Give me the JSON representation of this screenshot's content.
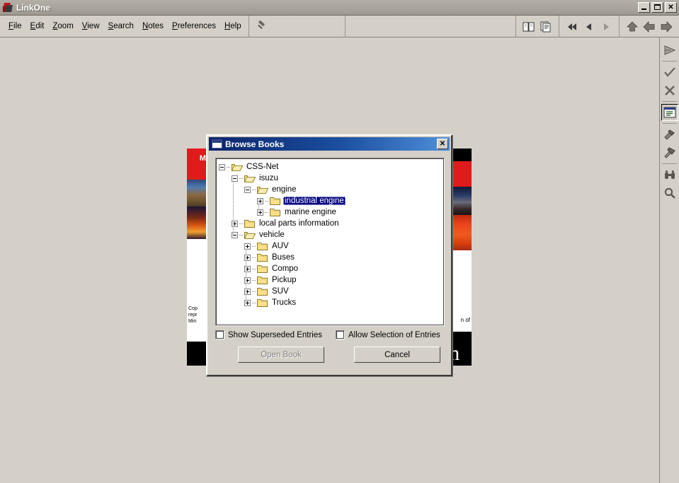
{
  "window": {
    "title": "LinkOne",
    "app_icon": "linkone-icon",
    "controls": {
      "minimize": "_",
      "maximize": "□",
      "close": "✕"
    }
  },
  "menubar": {
    "items": [
      {
        "label": "File",
        "accel": "F"
      },
      {
        "label": "Edit",
        "accel": "E"
      },
      {
        "label": "Zoom",
        "accel": "Z"
      },
      {
        "label": "View",
        "accel": "V"
      },
      {
        "label": "Search",
        "accel": "S"
      },
      {
        "label": "Notes",
        "accel": "N"
      },
      {
        "label": "Preferences",
        "accel": "P"
      },
      {
        "label": "Help",
        "accel": "H"
      }
    ],
    "pin_tool": "pushpin-icon"
  },
  "toolbar_right": {
    "groups": [
      {
        "buttons": [
          "book-icon",
          "document-notes-icon"
        ]
      },
      {
        "buttons": [
          "rewind-icon",
          "previous-icon",
          "next-icon"
        ]
      },
      {
        "buttons": [
          "arrow-up-icon",
          "arrow-left-icon",
          "arrow-right-icon"
        ]
      }
    ]
  },
  "toolbar_vertical": {
    "buttons": [
      {
        "name": "play-forward-icon",
        "pressed": false
      },
      {
        "name": "check-icon",
        "pressed": false
      },
      {
        "name": "cross-icon",
        "pressed": false
      },
      {
        "name": "list-panel-icon",
        "pressed": true
      },
      {
        "name": "hammer-icon",
        "pressed": false
      },
      {
        "name": "hammer-alt-icon",
        "pressed": false
      },
      {
        "name": "binoculars-icon",
        "pressed": false
      },
      {
        "name": "magnifier-icon",
        "pressed": false
      }
    ]
  },
  "background_document": {
    "cover_title": "Mi",
    "copyright_lines": [
      "Cop",
      "repr",
      "Min"
    ],
    "right_text": "n of",
    "big_letter": "m",
    "colors": {
      "red": "#e01b1b",
      "black": "#000000",
      "paper": "#ffffff"
    }
  },
  "dialog": {
    "title": "Browse Books",
    "icon": "window-icon",
    "close_label": "✕",
    "tree": {
      "nodes": [
        {
          "label": "CSS-Net",
          "depth": 0,
          "state": "expanded",
          "selected": false
        },
        {
          "label": "isuzu",
          "depth": 1,
          "state": "expanded",
          "selected": false
        },
        {
          "label": "engine",
          "depth": 2,
          "state": "expanded",
          "selected": false
        },
        {
          "label": "industrial engine",
          "depth": 3,
          "state": "collapsed",
          "selected": true
        },
        {
          "label": "marine engine",
          "depth": 3,
          "state": "collapsed",
          "selected": false
        },
        {
          "label": "local parts information",
          "depth": 1,
          "state": "collapsed",
          "selected": false
        },
        {
          "label": "vehicle",
          "depth": 1,
          "state": "expanded",
          "selected": false
        },
        {
          "label": "AUV",
          "depth": 2,
          "state": "collapsed",
          "selected": false
        },
        {
          "label": "Buses",
          "depth": 2,
          "state": "collapsed",
          "selected": false
        },
        {
          "label": "Compo",
          "depth": 2,
          "state": "collapsed",
          "selected": false
        },
        {
          "label": "Pickup",
          "depth": 2,
          "state": "collapsed",
          "selected": false
        },
        {
          "label": "SUV",
          "depth": 2,
          "state": "collapsed",
          "selected": false
        },
        {
          "label": "Trucks",
          "depth": 2,
          "state": "collapsed",
          "selected": false
        }
      ]
    },
    "checkboxes": [
      {
        "label": "Show Superseded Entries",
        "checked": false
      },
      {
        "label": "Allow Selection of Entries",
        "checked": false
      }
    ],
    "buttons": [
      {
        "label": "Open Book",
        "enabled": false
      },
      {
        "label": "Cancel",
        "enabled": true
      }
    ]
  },
  "colors": {
    "face": "#d4d0c8",
    "titlebar_active": "#0a246a",
    "selection": "#000080",
    "folder": "#ffe08a",
    "accent_red": "#c01818"
  }
}
